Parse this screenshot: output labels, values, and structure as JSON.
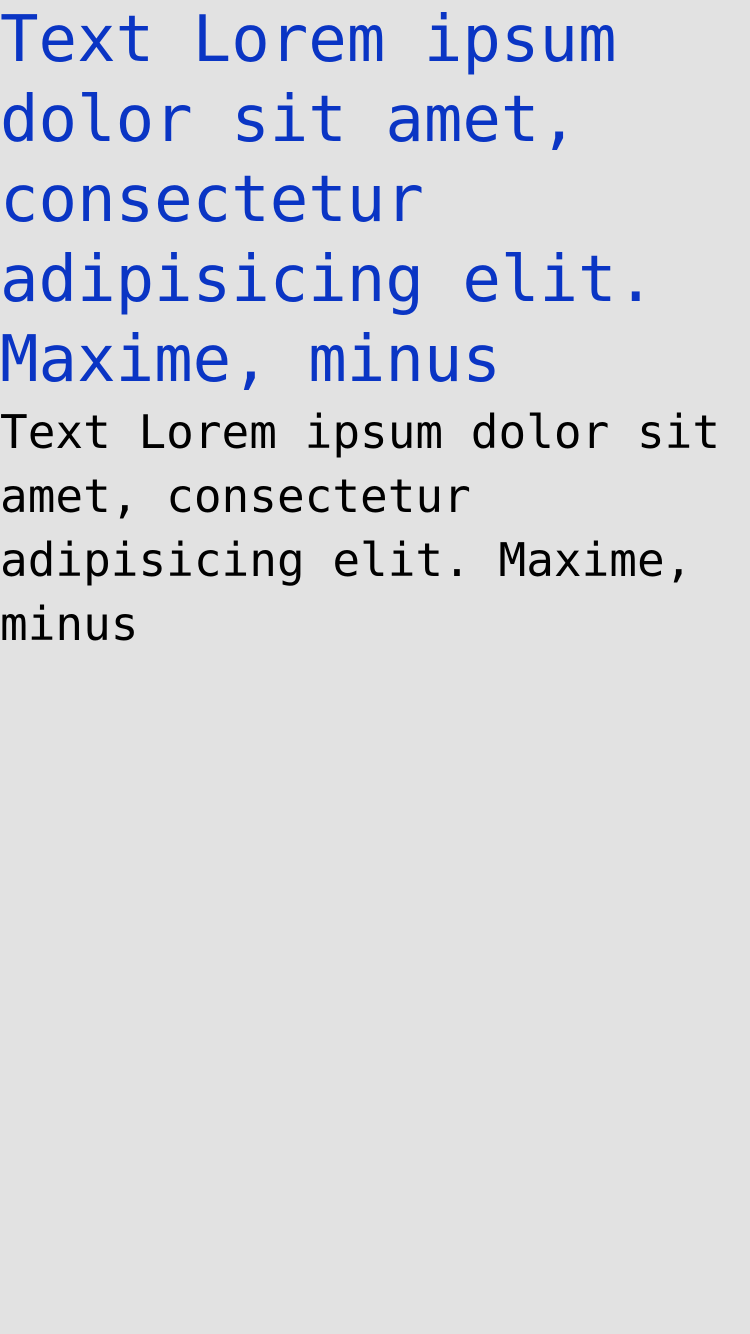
{
  "content": {
    "headline": "Text Lorem ipsum dolor sit amet, consectetur adipisicing elit. Maxime, minus",
    "body": "Text Lorem ipsum dolor sit amet, consectetur adipisicing elit. Maxime, minus"
  },
  "colors": {
    "background": "#e2e2e2",
    "headline": "#0a35c4",
    "body": "#000000"
  }
}
